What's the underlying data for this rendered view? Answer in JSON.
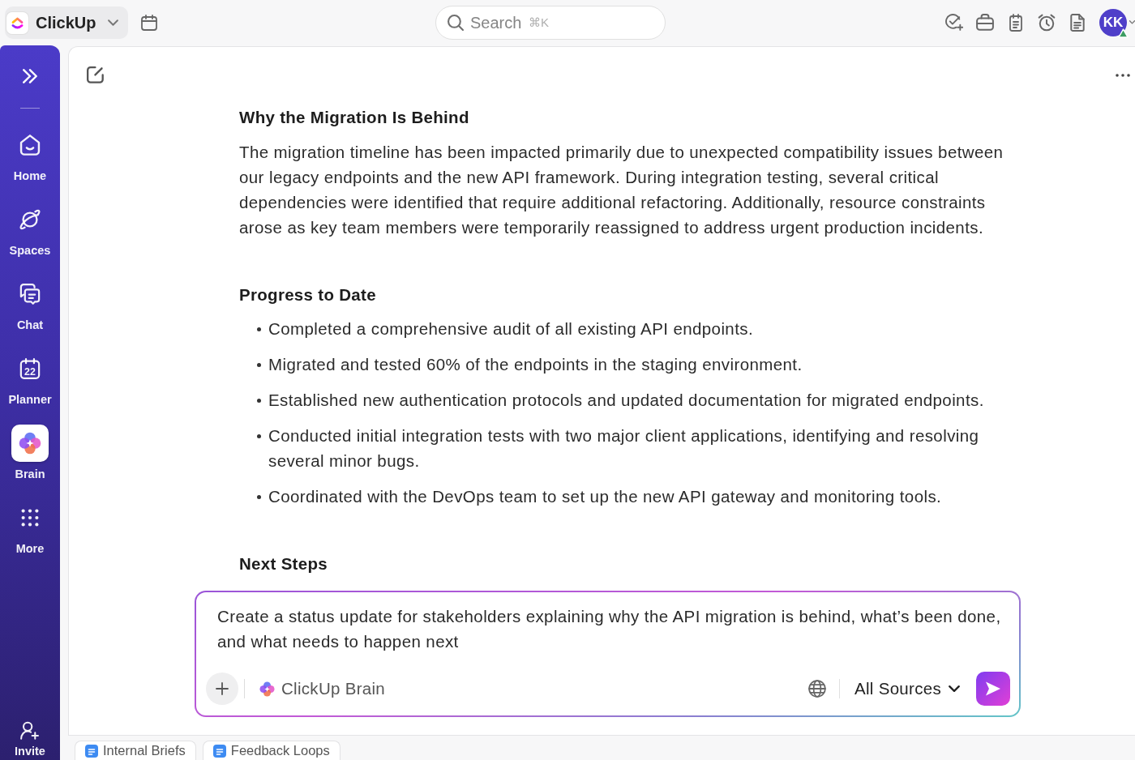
{
  "top_bar": {
    "workspace": {
      "name": "ClickUp"
    },
    "search": {
      "placeholder": "Search",
      "shortcut": "⌘K"
    },
    "avatar": {
      "initials": "KK",
      "online": true
    }
  },
  "sidebar": {
    "items": [
      {
        "label": "Home",
        "selected": false
      },
      {
        "label": "Spaces",
        "selected": false
      },
      {
        "label": "Chat",
        "selected": false
      },
      {
        "label": "Planner",
        "selected": false,
        "calendar_day": "22"
      },
      {
        "label": "Brain",
        "selected": true
      },
      {
        "label": "More",
        "selected": false
      }
    ],
    "invite": {
      "label": "Invite"
    }
  },
  "document": {
    "sections": [
      {
        "heading": "Why the Migration Is Behind",
        "paragraph": "The migration timeline has been impacted primarily due to unexpected compatibility issues between our legacy endpoints and the new API framework. During integration testing, several critical dependencies were identified that require additional refactoring. Additionally, resource constraints arose as key team members were temporarily reassigned to address urgent production incidents."
      },
      {
        "heading": "Progress to Date",
        "bullets": [
          "Completed a comprehensive audit of all existing API endpoints.",
          "Migrated and tested 60% of the endpoints in the staging environment.",
          "Established new authentication protocols and updated documentation for migrated endpoints.",
          "Conducted initial integration tests with two major client applications, identifying and resolving several minor bugs.",
          "Coordinated with the DevOps team to set up the new API gateway and monitoring tools."
        ]
      },
      {
        "heading": "Next Steps"
      }
    ]
  },
  "prompt": {
    "value": "Create a status update for stakeholders explaining why the API migration is behind, what’s been done, and what needs to happen next",
    "model": "ClickUp Brain",
    "sources": "All Sources"
  },
  "doc_tabs": [
    {
      "label": "Internal Briefs"
    },
    {
      "label": "Feedback Loops"
    }
  ]
}
